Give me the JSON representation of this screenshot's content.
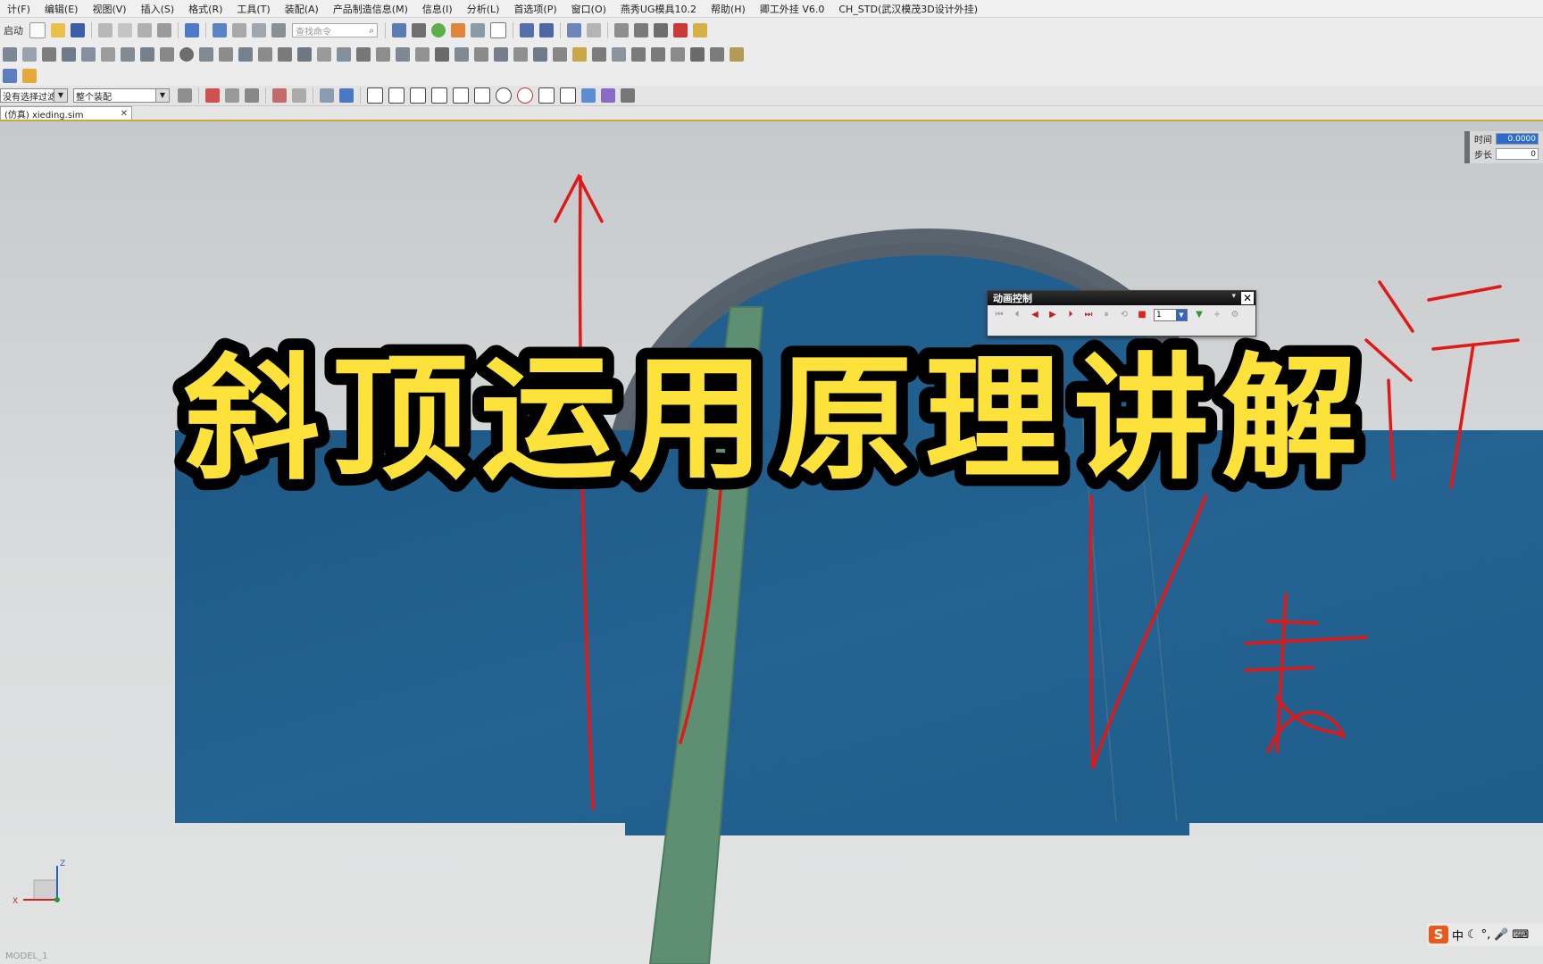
{
  "menu": [
    "计(F)",
    "编辑(E)",
    "视图(V)",
    "插入(S)",
    "格式(R)",
    "工具(T)",
    "装配(A)",
    "产品制造信息(M)",
    "信息(I)",
    "分析(L)",
    "首选项(P)",
    "窗口(O)",
    "燕秀UG模具10.2",
    "帮助(H)",
    "卿工外挂 V6.0",
    "CH_STD(武汉模茂3D设计外挂)"
  ],
  "toolbar": {
    "start_label": "启动",
    "search_placeholder": "查找命令",
    "filter_select": "没有选择过滤器",
    "assembly_select": "整个装配"
  },
  "tab": {
    "label": "(仿真) xieding.sim"
  },
  "time_panel": {
    "time_label": "时间",
    "time_value": "0.0000",
    "step_label": "步长",
    "step_value": "0"
  },
  "animation": {
    "title": "动画控制",
    "speed": "1"
  },
  "overlay_title": "斜顶运用原理讲解",
  "annotations": [
    "行",
    "表"
  ],
  "triad": {
    "x": "X",
    "z": "Z"
  },
  "status": {
    "model_label": "MODEL_1"
  },
  "ime": {
    "lang": "中"
  },
  "colors": {
    "part_blue": "#215f8e",
    "lifter_green": "#5f8f72",
    "pen_red": "#e01818",
    "title_yellow": "#fde23c"
  }
}
